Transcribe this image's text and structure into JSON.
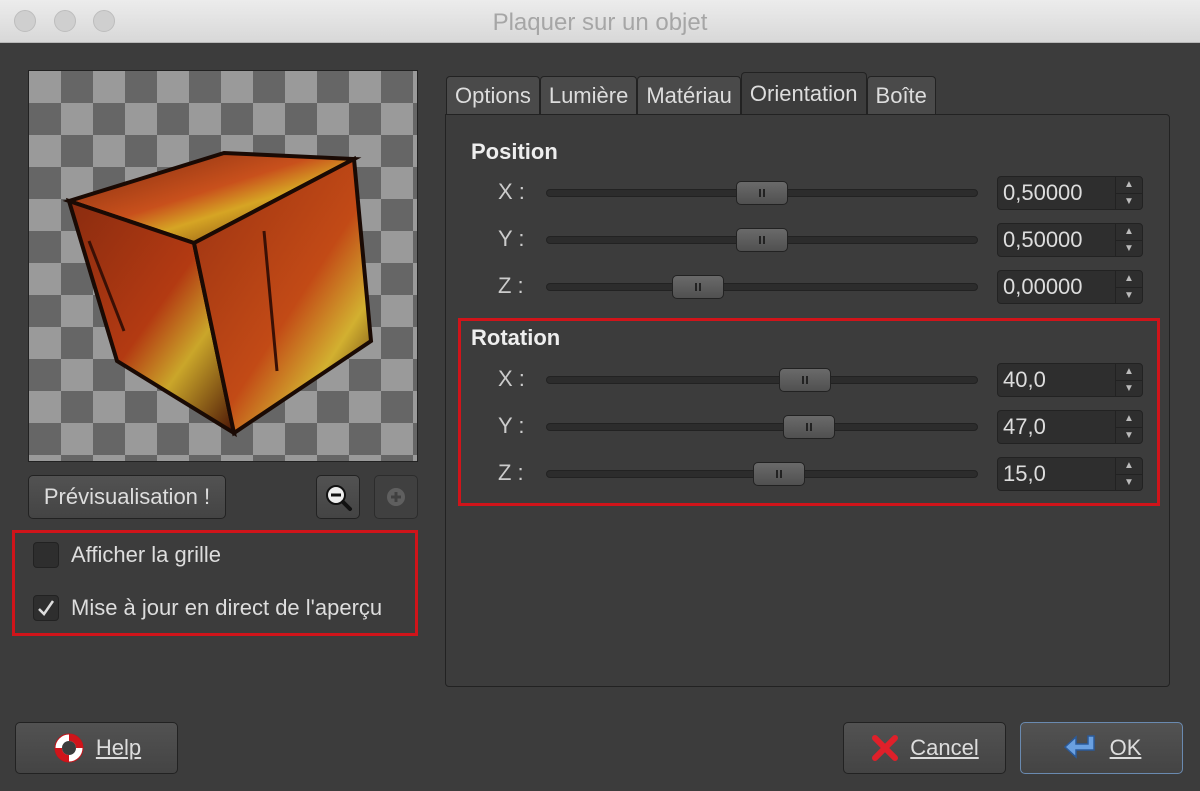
{
  "window": {
    "title": "Plaquer sur un objet"
  },
  "preview": {
    "button_label": "Prévisualisation !",
    "zoom_out": "zoom-out",
    "zoom_in": "zoom-in"
  },
  "checkboxes": [
    {
      "label": "Afficher la grille",
      "checked": false
    },
    {
      "label": "Mise à jour en direct de l'aperçu",
      "checked": true
    }
  ],
  "tabs": [
    {
      "label": "Options",
      "active": false
    },
    {
      "label": "Lumière",
      "active": false
    },
    {
      "label": "Matériau",
      "active": false
    },
    {
      "label": "Orientation",
      "active": true
    },
    {
      "label": "Boîte",
      "active": false
    }
  ],
  "orientation": {
    "position": {
      "title": "Position",
      "rows": [
        {
          "label": "X :",
          "value": "0,50000",
          "fraction": 0.5
        },
        {
          "label": "Y :",
          "value": "0,50000",
          "fraction": 0.5
        },
        {
          "label": "Z :",
          "value": "0,00000",
          "fraction": 0.35
        }
      ]
    },
    "rotation": {
      "title": "Rotation",
      "rows": [
        {
          "label": "X :",
          "value": "40,0",
          "fraction": 0.6
        },
        {
          "label": "Y :",
          "value": "47,0",
          "fraction": 0.61
        },
        {
          "label": "Z :",
          "value": "15,0",
          "fraction": 0.54
        }
      ]
    }
  },
  "buttons": {
    "help": "Help",
    "cancel": "Cancel",
    "ok": "OK"
  },
  "colors": {
    "highlight": "#d0141a",
    "background": "#3c3c3c"
  }
}
